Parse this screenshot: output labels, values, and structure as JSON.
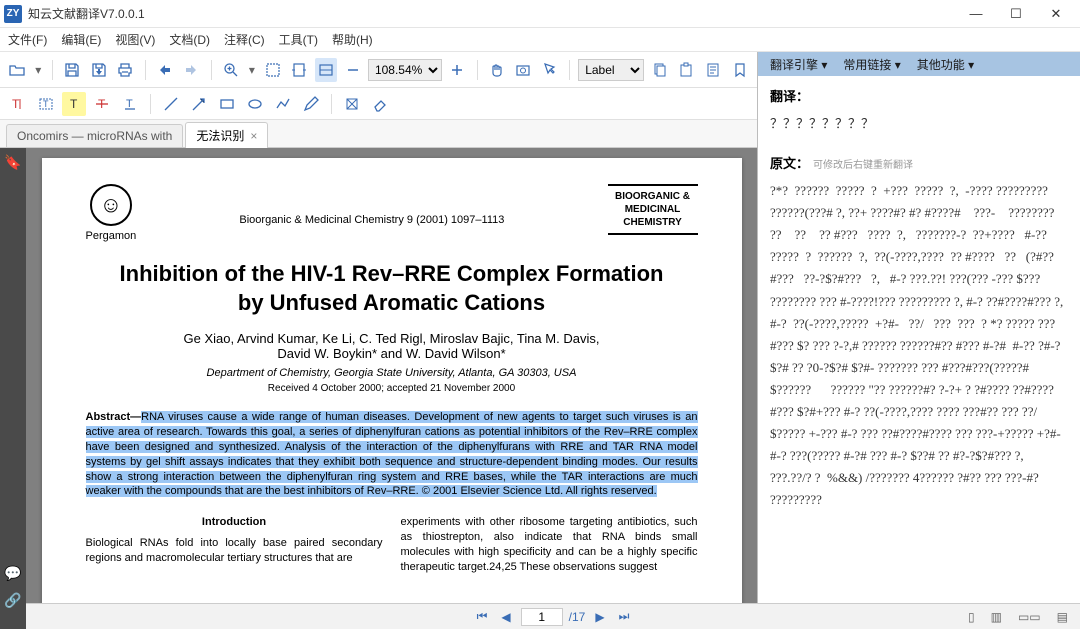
{
  "window": {
    "logo_text": "ZY",
    "title": "知云文献翻译V7.0.0.1",
    "min": "—",
    "max": "☐",
    "close": "✕"
  },
  "menu": {
    "file": "文件(F)",
    "edit": "编辑(E)",
    "view": "视图(V)",
    "document": "文档(D)",
    "comment": "注释(C)",
    "tools": "工具(T)",
    "help": "帮助(H)"
  },
  "toolbar": {
    "zoom_value": "108.54%",
    "label_value": "Label"
  },
  "tabs": {
    "tab1": "Oncomirs — microRNAs with",
    "tab2": "无法识别",
    "close": "×"
  },
  "paper": {
    "publisher": "Pergamon",
    "journal_ref": "Bioorganic & Medicinal Chemistry 9 (2001) 1097–1113",
    "journal_box_l1": "BIOORGANIC &",
    "journal_box_l2": "MEDICINAL",
    "journal_box_l3": "CHEMISTRY",
    "title_l1": "Inhibition of the HIV-1 Rev–RRE Complex Formation",
    "title_l2": "by Unfused Aromatic Cations",
    "authors_l1": "Ge Xiao, Arvind Kumar, Ke Li, C. Ted Rigl, Miroslav Bajic, Tina M. Davis,",
    "authors_l2": "David W. Boykin* and W. David Wilson*",
    "affiliation": "Department of Chemistry, Georgia State University, Atlanta, GA 30303, USA",
    "dates": "Received 4 October 2000; accepted 21 November 2000",
    "abstract_lead": "Abstract—",
    "abstract_body": "RNA viruses cause a wide range of human diseases. Development of new agents to target such viruses is an active area of research. Towards this goal, a series of diphenylfuran cations as potential inhibitors of the Rev–RRE complex have been designed and synthesized. Analysis of the interaction of the diphenylfurans with RRE and TAR RNA model systems by gel shift assays indicates that they exhibit both sequence and structure-dependent binding modes. Our results show a strong interaction between the diphenylfuran ring system and RRE bases, while the TAR interactions are much weaker with the compounds that are the best inhibitors of Rev–RRE. © 2001 Elsevier Science Ltd. All rights reserved.",
    "intro_heading": "Introduction",
    "col1_text": "Biological RNAs fold into locally base paired secondary regions and macromolecular tertiary structures that are",
    "col2_text": "experiments with other ribosome targeting antibiotics, such as thiostrepton, also indicate that RNA binds small molecules with high specificity and can be a highly specific therapeutic target.24,25 These observations suggest"
  },
  "pager": {
    "current": "1",
    "total": "/17"
  },
  "right": {
    "tab_engine": "翻译引擎",
    "tab_links": "常用链接",
    "tab_other": "其他功能",
    "dropdown": "▾",
    "translate_label": "翻译：",
    "translate_text": "？？？？？？？？",
    "original_label": "原文：",
    "original_note": "可修改后右键重新翻译",
    "original_text": "?*?  ??????  ?????  ?  +???  ?????  ?,  -???? ????????? ??????(???# ?, ??+ ????#? #? #????#    ???-    ????????    ??    ??    ?? #???   ????  ?,   ???????-?  ??+????   #-??  ?????  ?  ??????  ?,  ??(-????,????  ?? #????   ??   (?#??#???   ??-?$?#???   ?,   #-? ???.??! ???(??? -??? $??? ???????? ??? #-????!??? ????????? ?, #-? ??#????#??? ?, #-?  ??(-????,?????  +?#-   ??/   ???  ???  ? *? ????? ???#??? $? ??? ?-?,# ?????? ??????#?? #??? #-?#  #-?? ?#-?$?# ?? ?0-?$?# $?#- ??????? ??? #???#???(?????#      $??????      ?????? \"?? ??????#? ?-?+ ? ?#???? ??#????#??? $?#+??? #-? ??(-????,???? ???? ???#?? ??? ??/$????? +-??? #-? ??? ??#????#???? ??? ???-+????? +?#- #-? ???(????? #-?# ??? #-? $??# ?? #?-?$?#??? ?, ???.??/? ?  %&&) /??????? 4?????? ?#?? ??? ???-#? ?????????"
  }
}
